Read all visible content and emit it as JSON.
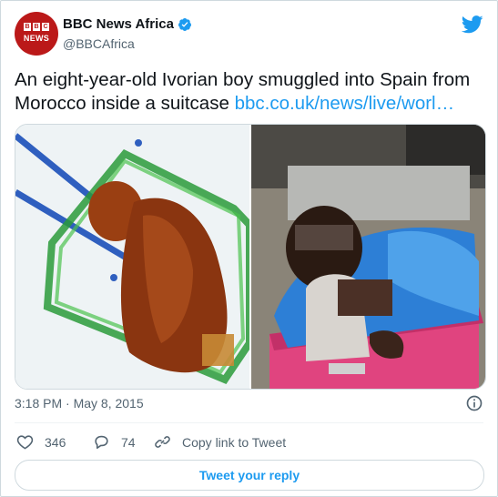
{
  "account": {
    "display_name": "BBC News Africa",
    "handle": "@BBCAfrica",
    "avatar_letters": [
      "B",
      "B",
      "C"
    ],
    "avatar_word": "NEWS",
    "verified": true
  },
  "tweet": {
    "text": "An eight-year-old Ivorian boy smuggled into Spain from Morocco inside a suitcase",
    "link": "bbc.co.uk/news/live/worl…",
    "timestamp": "3:18 PM · May 8, 2015"
  },
  "stats": {
    "likes": "346",
    "replies": "74",
    "copy_link_label": "Copy link to Tweet"
  },
  "reply_button_label": "Tweet your reply",
  "colors": {
    "accent": "#1d9bf0",
    "brand": "#bb1919",
    "muted_text": "#536471"
  },
  "icons": {
    "logo": "twitter-bird-icon",
    "verified": "verified-badge-icon",
    "info": "info-icon",
    "like": "heart-icon",
    "reply": "reply-bubble-icon",
    "copy_link": "link-icon"
  }
}
